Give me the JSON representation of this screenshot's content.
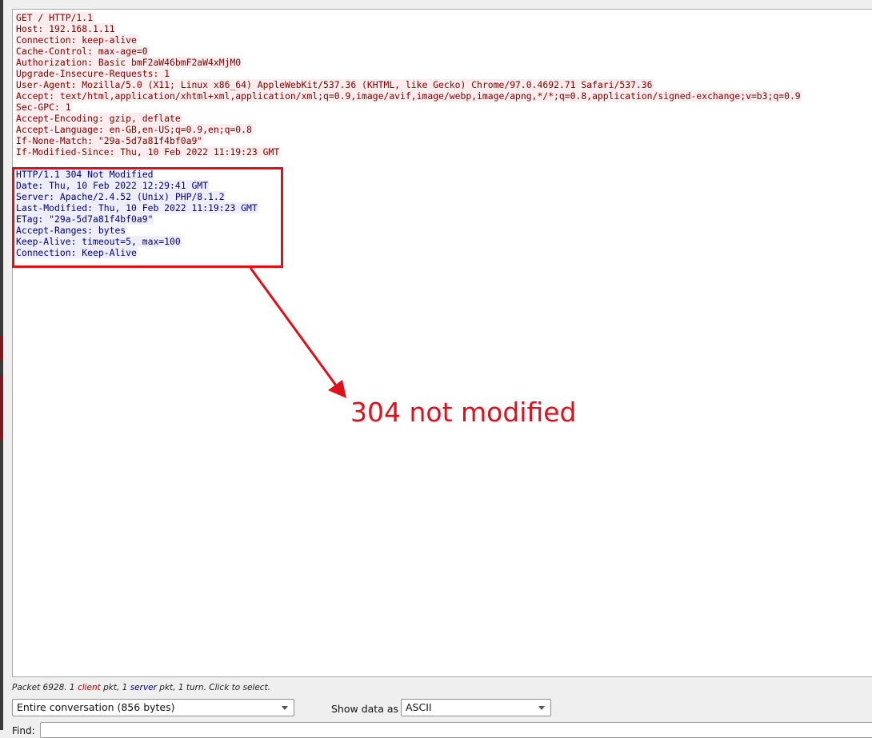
{
  "stream": {
    "client_lines": [
      "GET / HTTP/1.1",
      "Host: 192.168.1.11",
      "Connection: keep-alive",
      "Cache-Control: max-age=0",
      "Authorization: Basic bmF2aW46bmF2aW4xMjM0",
      "Upgrade-Insecure-Requests: 1",
      "User-Agent: Mozilla/5.0 (X11; Linux x86_64) AppleWebKit/537.36 (KHTML, like Gecko) Chrome/97.0.4692.71 Safari/537.36",
      "Accept: text/html,application/xhtml+xml,application/xml;q=0.9,image/avif,image/webp,image/apng,*/*;q=0.8,application/signed-exchange;v=b3;q=0.9",
      "Sec-GPC: 1",
      "Accept-Encoding: gzip, deflate",
      "Accept-Language: en-GB,en-US;q=0.9,en;q=0.8",
      "If-None-Match: \"29a-5d7a81f4bf0a9\"",
      "If-Modified-Since: Thu, 10 Feb 2022 11:19:23 GMT"
    ],
    "server_lines": [
      "HTTP/1.1 304 Not Modified",
      "Date: Thu, 10 Feb 2022 12:29:41 GMT",
      "Server: Apache/2.4.52 (Unix) PHP/8.1.2",
      "Last-Modified: Thu, 10 Feb 2022 11:19:23 GMT",
      "ETag: \"29a-5d7a81f4bf0a9\"",
      "Accept-Ranges: bytes",
      "Keep-Alive: timeout=5, max=100",
      "Connection: Keep-Alive"
    ]
  },
  "annotation": {
    "text": "304 not modified",
    "color": "#e0101a"
  },
  "status": {
    "prefix": "Packet 6928. 1 ",
    "client_word": "client",
    "middle": " pkt, 1 ",
    "server_word": "server",
    "suffix": " pkt, 1 turn. Click to select."
  },
  "controls": {
    "conversation_value": "Entire conversation (856 bytes)",
    "show_label": "Show data as",
    "show_value": "ASCII",
    "find_label": "Find:"
  },
  "colors": {
    "client_text": "#7d0000",
    "client_bg": "#fbeded",
    "server_text": "#000080",
    "server_bg": "#ededfb"
  }
}
